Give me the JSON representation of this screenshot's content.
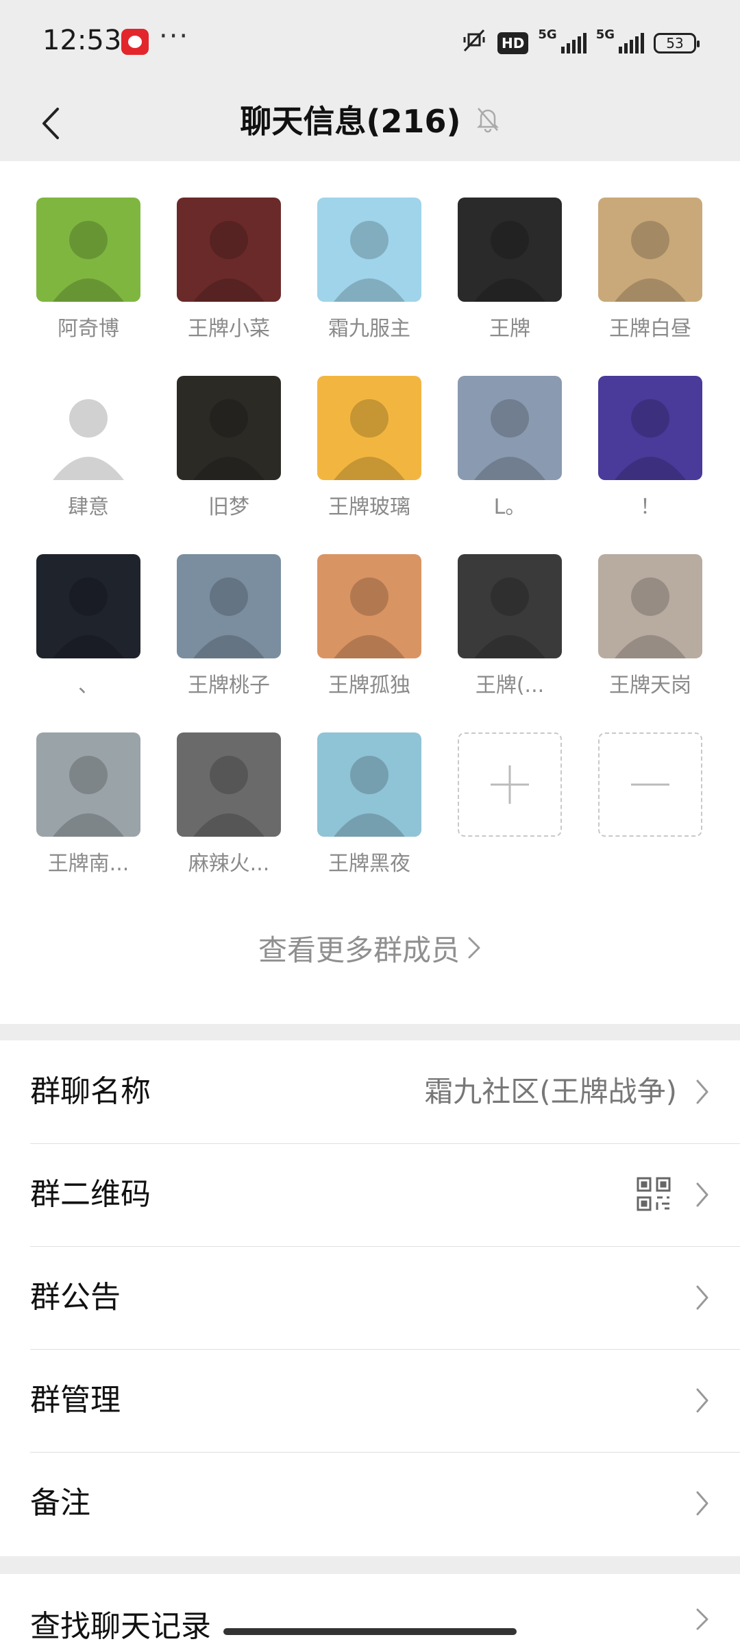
{
  "status_bar": {
    "time": "12:53",
    "dots": "···",
    "hd": "HD",
    "net1": "5G",
    "net2": "5G",
    "battery": "53"
  },
  "header": {
    "title": "聊天信息(216)",
    "back_icon": "chevron-left-icon",
    "mute_icon": "bell-off-icon"
  },
  "members": [
    {
      "name": "阿奇博",
      "bg": "#7fb640"
    },
    {
      "name": "王牌小菜",
      "bg": "#6b2a2a"
    },
    {
      "name": "霜九服主",
      "bg": "#9fd4ea"
    },
    {
      "name": "王牌",
      "bg": "#2a2a2a"
    },
    {
      "name": "王牌白昼",
      "bg": "#c9a97a"
    },
    {
      "name": "肆意",
      "bg": "#ffffff"
    },
    {
      "name": "旧梦",
      "bg": "#2c2a25"
    },
    {
      "name": "王牌玻璃",
      "bg": "#f2b640"
    },
    {
      "name": "L。",
      "bg": "#8a9ab0"
    },
    {
      "name": "！",
      "bg": "#4a3a9a"
    },
    {
      "name": "、",
      "bg": "#1f232c"
    },
    {
      "name": "王牌桃子",
      "bg": "#7a8ea0"
    },
    {
      "name": "王牌孤独",
      "bg": "#d99463"
    },
    {
      "name": "王牌(...",
      "bg": "#3a3a3a"
    },
    {
      "name": "王牌天岗",
      "bg": "#b8aba0"
    },
    {
      "name": "王牌南...",
      "bg": "#9aa3a8"
    },
    {
      "name": "麻辣火...",
      "bg": "#6a6a6a"
    },
    {
      "name": "王牌黑夜",
      "bg": "#8fc3d6"
    }
  ],
  "add_button_icon": "plus-icon",
  "remove_button_icon": "minus-icon",
  "view_more": "查看更多群成员",
  "settings": [
    {
      "label": "群聊名称",
      "value": "霜九社区(王牌战争)"
    },
    {
      "label": "群二维码",
      "value": ""
    },
    {
      "label": "群公告",
      "value": ""
    },
    {
      "label": "群管理",
      "value": ""
    },
    {
      "label": "备注",
      "value": ""
    }
  ],
  "next_section_label": "查找聊天记录"
}
